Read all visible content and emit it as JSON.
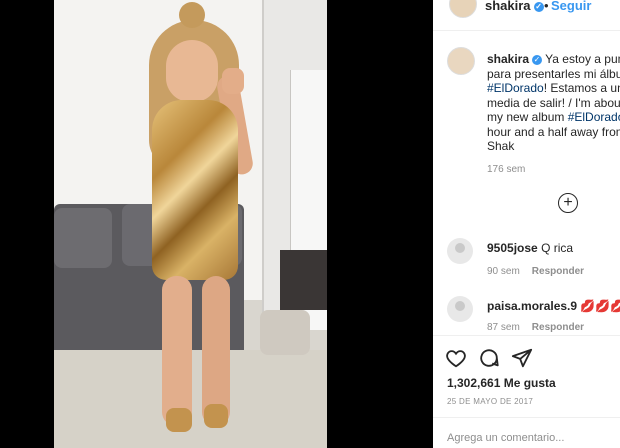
{
  "header": {
    "username": "shakira",
    "separator": "•",
    "follow_label": "Seguir"
  },
  "caption": {
    "username": "shakira",
    "lines": [
      "Ya estoy a punto",
      "para presentarles mi álbum",
      "#ElDorado! Estamos a una",
      "media de salir! / I'm about",
      "my new album #ElDorado!",
      "hour and a half away from",
      "Shak"
    ],
    "hashtag": "#ElDorado",
    "time": "176 sem"
  },
  "comments": [
    {
      "username": "9505jose",
      "text": "Q rica",
      "time": "90 sem",
      "reply_label": "Responder"
    },
    {
      "username": "paisa.morales.9",
      "text": "💋💋💋",
      "time": "87 sem",
      "reply_label": "Responder"
    }
  ],
  "post": {
    "likes": "1,302,661 Me gusta",
    "date": "25 DE MAYO DE 2017",
    "add_comment_placeholder": "Agrega un comentario..."
  },
  "icons": [
    "heart-icon",
    "comment-icon",
    "share-icon",
    "plus-circle-icon",
    "verified-badge-icon"
  ],
  "colors": {
    "link": "#3897f0",
    "hashtag": "#003569",
    "muted": "#8e8e8e"
  }
}
